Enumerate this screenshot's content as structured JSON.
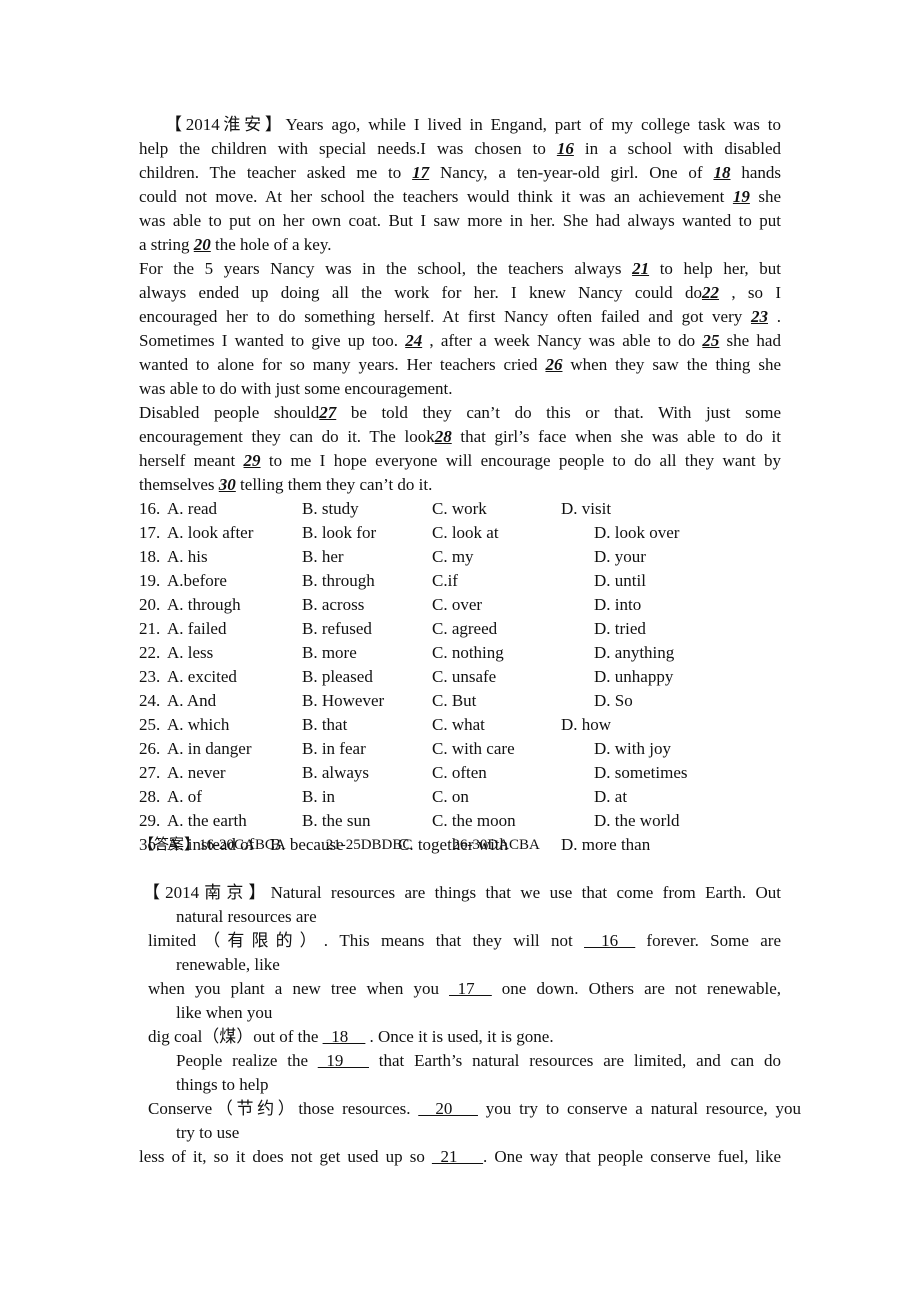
{
  "passage1": {
    "source": "【2014淮安】",
    "lines": [
      [
        "Years ago, while I lived in Engand, part of my college task was to"
      ],
      [
        "help the children with special needs.I was chosen to ",
        "16",
        " in a school with disabled"
      ],
      [
        "children. The teacher asked me to ",
        "17",
        " Nancy, a ten-year-old girl. One of ",
        "18",
        " hands"
      ],
      [
        "could not move. At her school the teachers would think it was an achievement ",
        "19",
        " she"
      ],
      [
        "was able to put on her own coat. But I saw more in her. She had always wanted to put"
      ],
      [
        "a string ",
        "20",
        " the hole of a key."
      ],
      [
        "For the 5 years Nancy was in the school, the teachers always ",
        "21",
        " to help her, but"
      ],
      [
        "always ended up doing all the work for her. I knew Nancy could do",
        "22",
        " , so I"
      ],
      [
        "encouraged her to do something herself. At first Nancy often failed and got very ",
        "23",
        " ."
      ],
      [
        "Sometimes I wanted to give up too. ",
        "24",
        " , after a week Nancy was able to do ",
        "25",
        " she had"
      ],
      [
        "wanted to alone for so many years. Her teachers cried ",
        "26",
        " when they saw the thing she"
      ],
      [
        "was able to do with just some encouragement."
      ],
      [
        "Disabled people should",
        "27",
        " be told they can’t do this or that. With just some"
      ],
      [
        "encouragement they can do it. The look",
        "28",
        " that girl’s face when she was able to do it"
      ],
      [
        "herself meant ",
        "29",
        " to me I hope everyone will encourage people to do all they want by"
      ],
      [
        "themselves ",
        "30",
        " telling them they can’t do it."
      ]
    ]
  },
  "questions": [
    {
      "num": "16.",
      "A": "A. read",
      "B": "B. study",
      "C": "C. work",
      "D": "D. visit"
    },
    {
      "num": "17.",
      "A": "A. look after",
      "B": "B. look for",
      "C": "C. look at",
      "D": "D. look over"
    },
    {
      "num": "18.",
      "A": "A. his",
      "B": "B. her",
      "C": "C. my",
      "D": "D. your"
    },
    {
      "num": "19.",
      "A": "A.before",
      "B": "B. through",
      "C": "C.if",
      "D": "D. until"
    },
    {
      "num": "20.",
      "A": "A. through",
      "B": "B. across",
      "C": "C. over",
      "D": "D. into"
    },
    {
      "num": "21.",
      "A": "A. failed",
      "B": "B. refused",
      "C": "C. agreed",
      "D": "D. tried"
    },
    {
      "num": "22.",
      "A": "A. less",
      "B": "B. more",
      "C": "C. nothing",
      "D": "D. anything"
    },
    {
      "num": "23.",
      "A": "A. excited",
      "B": "B. pleased",
      "C": "C. unsafe",
      "D": "D. unhappy"
    },
    {
      "num": "24.",
      "A": "A. And",
      "B": "B. However",
      "C": "C. But",
      "D": "D. So"
    },
    {
      "num": "25.",
      "A": "A. which",
      "B": "B. that",
      "C": "C. what",
      "D": "D. how"
    },
    {
      "num": "26.",
      "A": "A. in danger",
      "B": "B. in fear",
      "C": "C. with care",
      "D": "D. with joy"
    },
    {
      "num": "27.",
      "A": "A. never",
      "B": "B. always",
      "C": "C. often",
      "D": "D. sometimes"
    },
    {
      "num": "28.",
      "A": "A. of",
      "B": "B. in",
      "C": "C. on",
      "D": "D. at"
    },
    {
      "num": "29.",
      "A": "A. the earth",
      "B": "B. the sun",
      "C": "C. the moon",
      "D": "D. the world"
    },
    {
      "num": "3o.",
      "A": "A. instead of",
      "B": "B. because",
      "C": "C. together with",
      "D": "D. more than"
    }
  ],
  "answer": {
    "label": "【答案】",
    "groups": [
      "16-20CABCA",
      "21-25DBDBC",
      "26-30DACBA"
    ]
  },
  "passage2": {
    "source": "【2014南京】",
    "lines": [
      [
        "Natural resources are things that we use that come from Earth.    Out"
      ],
      [
        "natural resources are"
      ],
      [
        "limited（有限的）.    This means that they will not ",
        "__16__",
        "  forever.    Some are"
      ],
      [
        "renewable, like"
      ],
      [
        "when you plant a new tree when you ",
        "_17__",
        "  one down.    Others are not renewable,"
      ],
      [
        "like when you"
      ],
      [
        "dig coal（煤）out of the ",
        "_18__",
        "  . Once it is used, it is gone."
      ],
      [
        "People realize the ",
        "_19___",
        "  that Earth’s natural resources are limited, and can do"
      ],
      [
        "things to help"
      ],
      [
        "Conserve（节约）those resources. ",
        "__20___",
        "  you try to conserve a natural resource, you"
      ],
      [
        "try to use"
      ],
      [
        "less of it, so it does not get used up so ",
        "_21___",
        ". One way that people conserve fuel, like"
      ]
    ]
  }
}
